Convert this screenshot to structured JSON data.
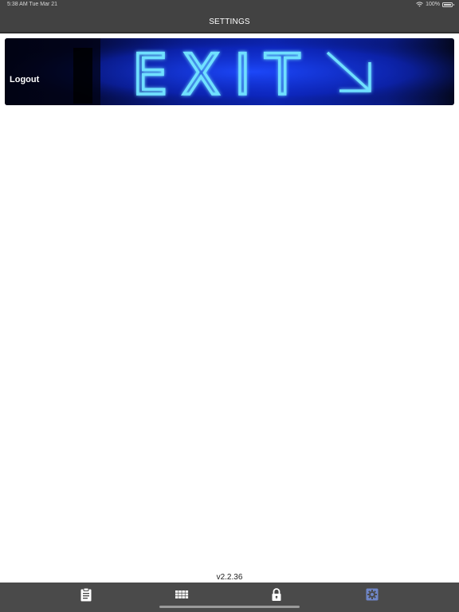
{
  "status_bar": {
    "time": "5:38 AM",
    "date": "Tue Mar 21",
    "battery": "100%"
  },
  "header": {
    "title": "SETTINGS"
  },
  "logout": {
    "label": "Logout",
    "sign_text": "EXIT"
  },
  "footer": {
    "version": "v2.2.36"
  },
  "tabs": [
    {
      "icon": "clipboard-icon",
      "active": false
    },
    {
      "icon": "keypad-icon",
      "active": false
    },
    {
      "icon": "lock-icon",
      "active": false
    },
    {
      "icon": "settings-icon",
      "active": true
    }
  ],
  "colors": {
    "bar_background": "#424242",
    "tab_background": "#4a4a4a",
    "active_tab": "#6f86c8",
    "neon_blue": "#39c6ff"
  }
}
